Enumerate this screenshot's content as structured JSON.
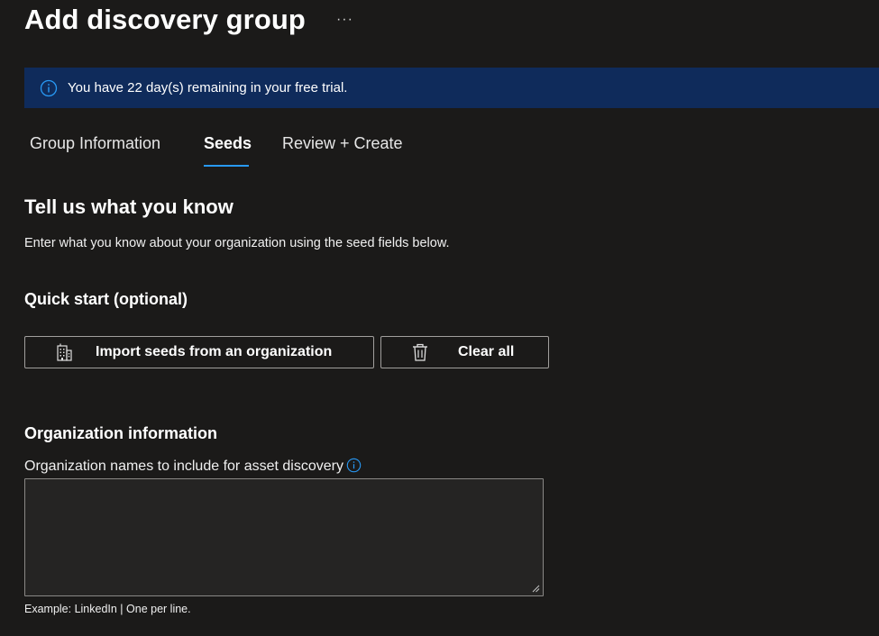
{
  "header": {
    "title": "Add discovery group",
    "more_label": "···"
  },
  "banner": {
    "icon": "info-icon",
    "text": "You have 22 day(s) remaining in your free trial."
  },
  "tabs": [
    {
      "label": "Group Information",
      "active": false
    },
    {
      "label": "Seeds",
      "active": true
    },
    {
      "label": "Review + Create",
      "active": false
    }
  ],
  "main": {
    "title": "Tell us what you know",
    "description": "Enter what you know about your organization using the seed fields below.",
    "quick_start": {
      "title": "Quick start (optional)",
      "import_label": "Import seeds from an organization",
      "import_icon": "building-icon",
      "clear_label": "Clear all",
      "clear_icon": "trash-icon"
    },
    "organization": {
      "title": "Organization information",
      "names_label": "Organization names to include for asset discovery",
      "names_value": "",
      "hint": "Example: LinkedIn | One per line."
    }
  },
  "colors": {
    "background": "#1b1a19",
    "banner": "#0f2b5b",
    "accent": "#2899f5",
    "border": "#a19f9d"
  }
}
